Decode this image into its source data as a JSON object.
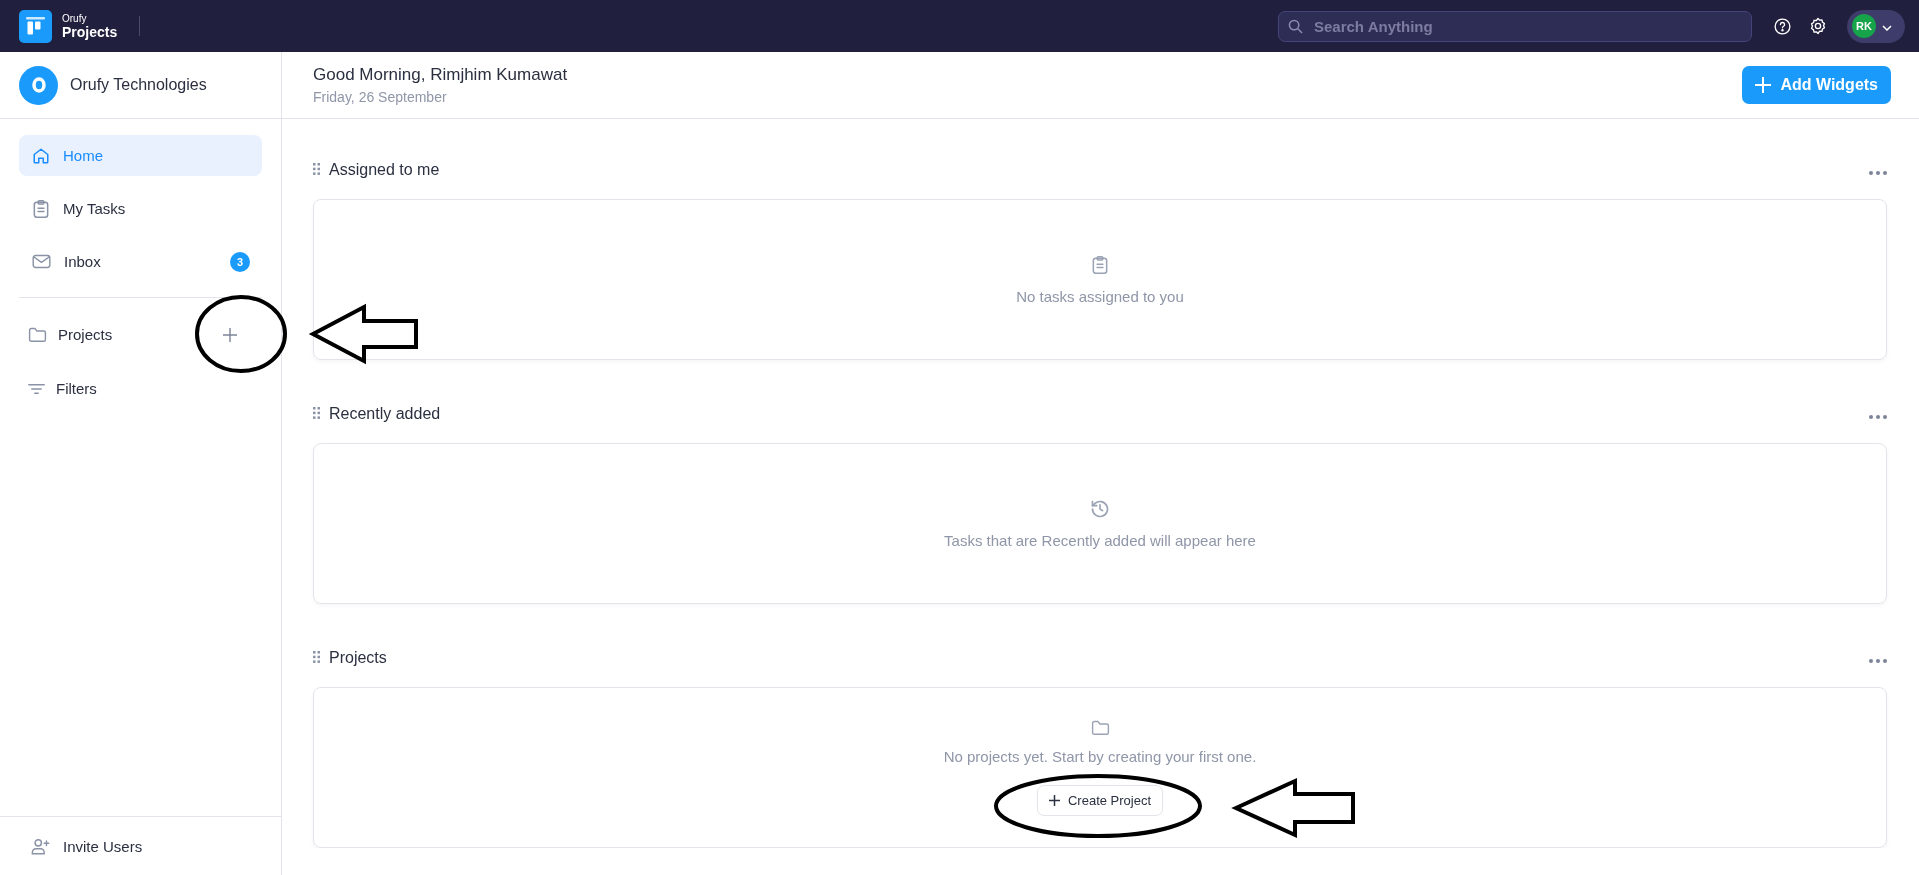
{
  "app": {
    "brand_small": "Orufy",
    "brand_name": "Projects"
  },
  "search": {
    "placeholder": "Search Anything"
  },
  "user": {
    "initials": "RK"
  },
  "sidebar": {
    "org_name": "Orufy Technologies",
    "nav": [
      {
        "label": "Home",
        "kind": "home",
        "selected": true
      },
      {
        "label": "My Tasks",
        "kind": "tasks",
        "selected": false
      },
      {
        "label": "Inbox",
        "kind": "inbox",
        "selected": false,
        "badge": "3"
      }
    ],
    "groups": [
      {
        "label": "Projects",
        "kind": "projects",
        "add": true
      },
      {
        "label": "Filters",
        "kind": "filters",
        "add": false
      }
    ],
    "footer": {
      "label": "Invite Users"
    }
  },
  "header": {
    "greeting": "Good Morning, Rimjhim Kumawat",
    "date": "Friday, 26 September",
    "action": "Add Widgets"
  },
  "widgets": [
    {
      "title": "Assigned to me",
      "kind": "tasks",
      "message": "No tasks assigned to you"
    },
    {
      "title": "Recently added",
      "kind": "recent",
      "message": "Tasks that are Recently added will appear here"
    },
    {
      "title": "Projects",
      "kind": "projects",
      "message": "No projects yet. Start by creating your first one.",
      "action": "Create Project"
    }
  ]
}
